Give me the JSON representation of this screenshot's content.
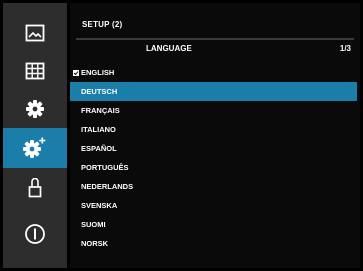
{
  "sidebar": {
    "items": [
      {
        "icon": "photo-icon",
        "active": false
      },
      {
        "icon": "grid-icon",
        "active": false
      },
      {
        "icon": "gear-icon",
        "active": false
      },
      {
        "icon": "gear-plus-icon",
        "active": true
      },
      {
        "icon": "lock-icon",
        "active": false
      },
      {
        "icon": "info-icon",
        "active": false
      }
    ]
  },
  "header": {
    "title": "SETUP (2)",
    "section": "LANGUAGE",
    "page": "1/3"
  },
  "languages": [
    {
      "label": "ENGLISH",
      "checked": true,
      "highlighted": false
    },
    {
      "label": "DEUTSCH",
      "checked": false,
      "highlighted": true
    },
    {
      "label": "FRANÇAIS",
      "checked": false,
      "highlighted": false
    },
    {
      "label": "ITALIANO",
      "checked": false,
      "highlighted": false
    },
    {
      "label": "ESPAÑOL",
      "checked": false,
      "highlighted": false
    },
    {
      "label": "PORTUGUÊS",
      "checked": false,
      "highlighted": false
    },
    {
      "label": "NEDERLANDS",
      "checked": false,
      "highlighted": false
    },
    {
      "label": "SVENSKA",
      "checked": false,
      "highlighted": false
    },
    {
      "label": "SUOMI",
      "checked": false,
      "highlighted": false
    },
    {
      "label": "NORSK",
      "checked": false,
      "highlighted": false
    }
  ],
  "colors": {
    "accent": "#1b7ea8",
    "sidebar": "#2d2d2d",
    "panel": "#0a0a0a"
  }
}
